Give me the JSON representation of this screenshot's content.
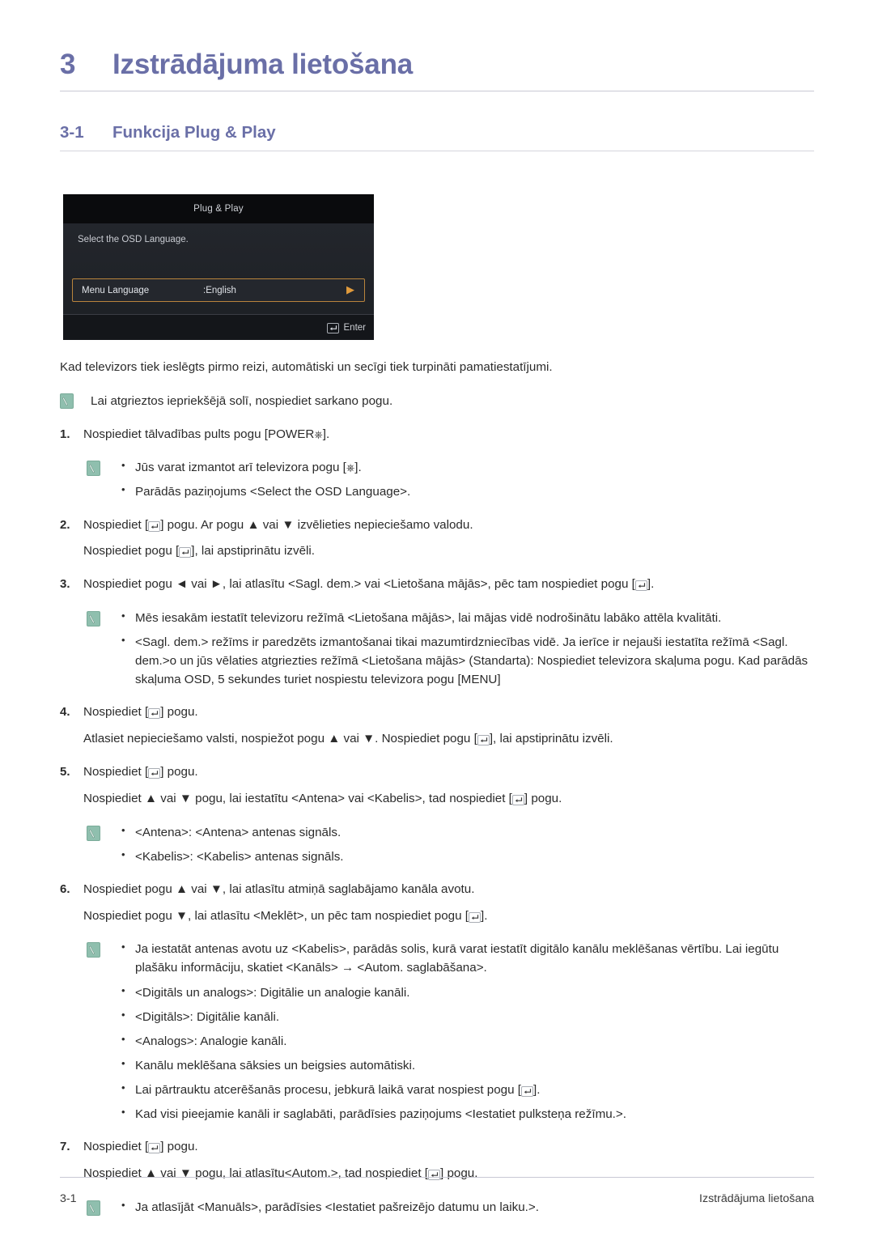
{
  "chapter": {
    "number": "3",
    "title": "Izstrādājuma lietošana"
  },
  "section": {
    "number": "3-1",
    "title": "Funkcija Plug & Play"
  },
  "osd": {
    "title": "Plug & Play",
    "prompt": "Select the OSD Language.",
    "row_label": "Menu Language",
    "row_value": ":English",
    "enter_label": "Enter",
    "border_color": "#b9843c",
    "arrow_color": "#e09a3c",
    "background": "#21242a"
  },
  "intro": "Kad televizors tiek ieslēgts pirmo reizi, automātiski un secīgi tiek turpināti pamatiestatījumi.",
  "note_top": "Lai atgrieztos iepriekšējā solī, nospiediet sarkano pogu.",
  "steps": {
    "s1": {
      "num": "1.",
      "text_a": "Nospiediet tālvadības pults pogu [POWER",
      "text_b": "].",
      "notes": [
        {
          "a": "Jūs varat izmantot arī televizora pogu [",
          "b": "]."
        },
        {
          "a": "Parādās paziņojums <Select the OSD Language>.",
          "b": ""
        }
      ]
    },
    "s2": {
      "num": "2.",
      "line1_a": "Nospiediet [",
      "line1_b": "] pogu. Ar pogu ▲ vai ▼ izvēlieties nepieciešamo valodu.",
      "line2_a": "Nospiediet pogu [",
      "line2_b": "], lai apstiprinātu izvēli."
    },
    "s3": {
      "num": "3.",
      "text_a": "Nospiediet pogu ◄ vai ►, lai atlasītu <Sagl. dem.> vai <Lietošana mājās>, pēc tam nospiediet pogu [",
      "text_b": "].",
      "notes": [
        "Mēs iesakām iestatīt televizoru režīmā <Lietošana mājās>, lai mājas vidē nodrošinātu labāko attēla kvalitāti.",
        "<Sagl. dem.> režīms ir paredzēts izmantošanai tikai mazumtirdzniecības vidē. Ja ierīce ir nejauši iestatīta režīmā <Sagl. dem.>o un jūs vēlaties atgriezties režīmā <Lietošana mājās> (Standarta): Nospiediet televizora skaļuma pogu. Kad parādās skaļuma OSD, 5 sekundes turiet nospiestu televizora pogu [MENU]"
      ]
    },
    "s4": {
      "num": "4.",
      "line1_a": "Nospiediet [",
      "line1_b": "] pogu.",
      "line2_a": "Atlasiet nepieciešamo valsti, nospiežot pogu ▲ vai ▼. Nospiediet pogu [",
      "line2_b": "], lai apstiprinātu izvēli."
    },
    "s5": {
      "num": "5.",
      "line1_a": "Nospiediet [",
      "line1_b": "] pogu.",
      "line2_a": "Nospiediet ▲ vai ▼ pogu, lai iestatītu <Antena> vai <Kabelis>, tad nospiediet [",
      "line2_b": "] pogu.",
      "notes": [
        "<Antena>: <Antena> antenas signāls.",
        "<Kabelis>: <Kabelis> antenas signāls."
      ]
    },
    "s6": {
      "num": "6.",
      "line1": "Nospiediet pogu ▲ vai ▼, lai atlasītu atmiņā saglabājamo kanāla avotu.",
      "line2_a": "Nospiediet pogu ▼, lai atlasītu <Meklēt>, un pēc tam nospiediet pogu [",
      "line2_b": "].",
      "notes": [
        "Ja iestatāt antenas avotu uz <Kabelis>, parādās solis, kurā varat iestatīt digitālo kanālu meklēšanas vērtību. Lai iegūtu plašāku informāciju, skatiet <Kanāls> → <Autom. saglabāšana>.",
        "<Digitāls un analogs>: Digitālie un analogie kanāli.",
        "<Digitāls>: Digitālie kanāli.",
        "<Analogs>: Analogie kanāli.",
        "Kanālu meklēšana sāksies un beigsies automātiski."
      ],
      "notes_with_key": [
        {
          "a": "Lai pārtrauktu atcerēšanās procesu, jebkurā laikā varat nospiest pogu [",
          "b": "]."
        },
        {
          "a": "Kad visi pieejamie kanāli ir saglabāti, parādīsies paziņojums <Iestatiet pulksteņa režīmu.>.",
          "b": ""
        }
      ]
    },
    "s7": {
      "num": "7.",
      "line1_a": "Nospiediet [",
      "line1_b": "] pogu.",
      "line2_a": "Nospiediet ▲ vai ▼ pogu, lai atlasītu<Autom.>, tad nospiediet [",
      "line2_b": "] pogu.",
      "notes": [
        "Ja atlasījāt <Manuāls>, parādīsies <Iestatiet pašreizējo datumu un laiku.>."
      ]
    }
  },
  "footer": {
    "left": "3-1",
    "right": "Izstrādājuma lietošana"
  },
  "icons": {
    "note": "note-pencil-icon",
    "enter_key": "enter-key-icon",
    "power": "power-icon"
  },
  "colors": {
    "heading": "#6a6fa7",
    "body_text": "#2b2b2b",
    "note_icon": "#8fbfae"
  }
}
